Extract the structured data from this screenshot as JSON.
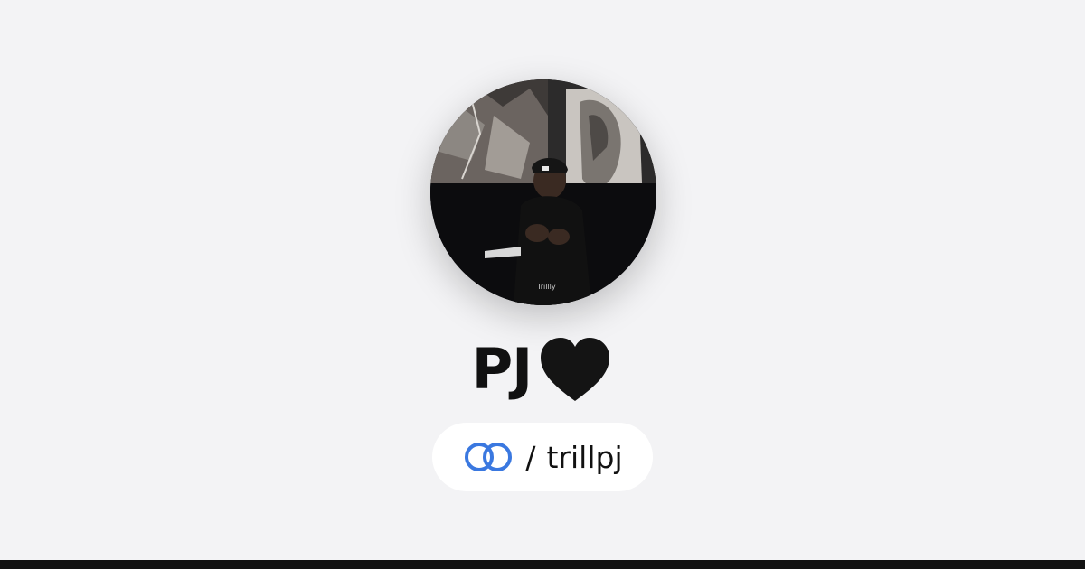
{
  "profile": {
    "display_name": "PJ",
    "name_emoji": "black-heart",
    "avatar": "profile-photo",
    "handle_separator": "/",
    "handle": "trillpj"
  },
  "icons": {
    "link_icon": "interlocking-rings-icon",
    "link_icon_color": "#3a78e0"
  },
  "colors": {
    "background": "#f3f3f5",
    "pill": "#ffffff",
    "bottom_bar": "#121212"
  }
}
